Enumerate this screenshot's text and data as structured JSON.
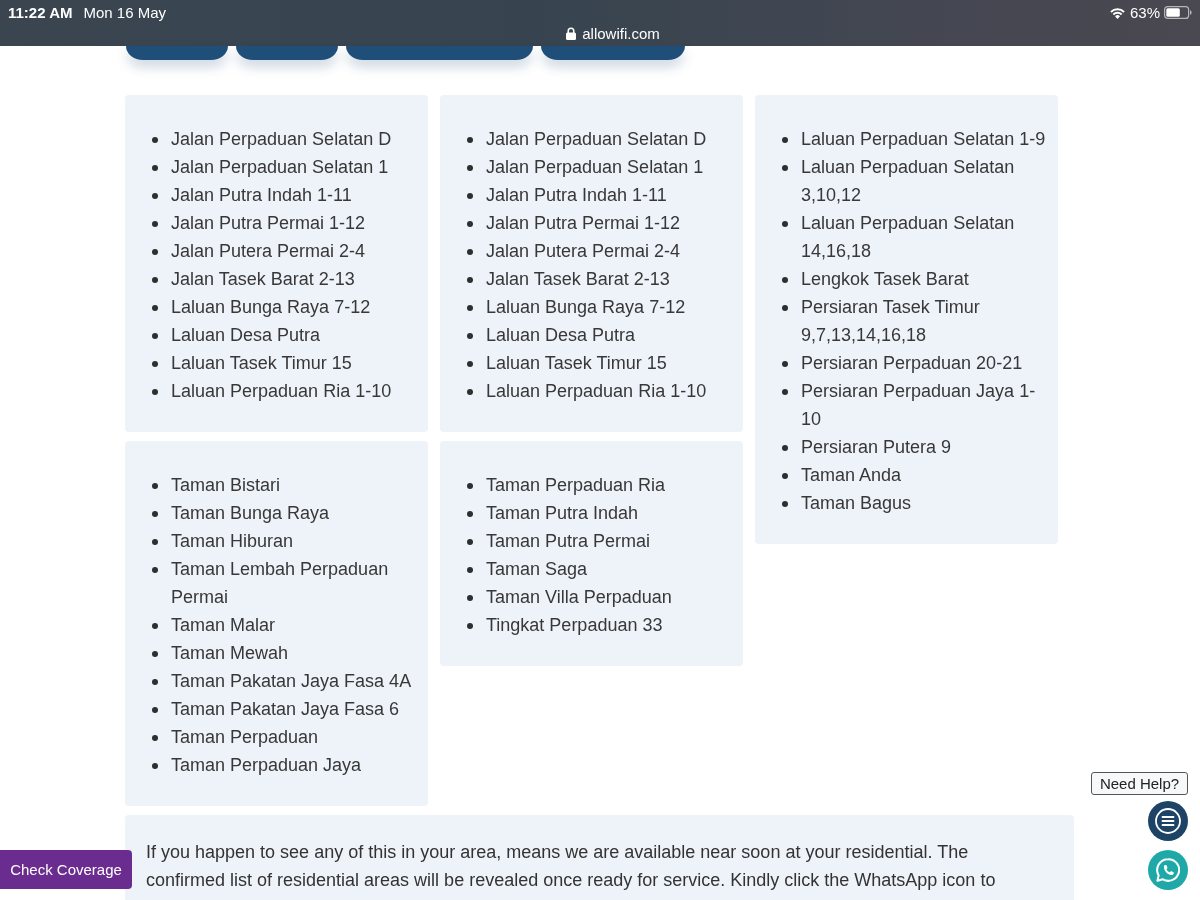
{
  "status_bar": {
    "time": "11:22 AM",
    "date": "Mon 16 May",
    "url": "allowifi.com",
    "battery": "63%"
  },
  "area_buttons": [
    {
      "kind": "short"
    },
    {
      "kind": "short"
    },
    {
      "kind": "long"
    },
    {
      "kind": "medium"
    }
  ],
  "columns": [
    {
      "cards": [
        {
          "items": [
            "Jalan Perpaduan Selatan D",
            "Jalan Perpaduan Selatan 1",
            "Jalan Putra Indah 1-11",
            "Jalan Putra Permai 1-12",
            "Jalan Putera Permai 2-4",
            "Jalan Tasek Barat 2-13",
            "Laluan Bunga Raya 7-12",
            "Laluan Desa Putra",
            "Laluan Tasek Timur 15",
            "Laluan Perpaduan Ria 1-10"
          ]
        },
        {
          "items": [
            "Taman Bistari",
            "Taman Bunga Raya",
            "Taman Hiburan",
            "Taman Lembah Perpaduan Permai",
            "Taman Malar",
            "Taman Mewah",
            "Taman Pakatan Jaya Fasa 4A",
            "Taman Pakatan Jaya Fasa 6",
            "Taman Perpaduan",
            "Taman Perpaduan Jaya"
          ]
        }
      ]
    },
    {
      "cards": [
        {
          "items": [
            "Jalan Perpaduan Selatan D",
            "Jalan Perpaduan Selatan 1",
            "Jalan Putra Indah 1-11",
            "Jalan Putra Permai 1-12",
            "Jalan Putera Permai 2-4",
            "Jalan Tasek Barat 2-13",
            "Laluan Bunga Raya 7-12",
            "Laluan Desa Putra",
            "Laluan Tasek Timur 15",
            "Laluan Perpaduan Ria 1-10"
          ]
        },
        {
          "items": [
            "Taman Perpaduan Ria",
            "Taman Putra Indah",
            "Taman Putra Permai",
            "Taman Saga",
            "Taman Villa Perpaduan",
            "Tingkat Perpaduan 33"
          ]
        }
      ]
    },
    {
      "cards": [
        {
          "items": [
            "Laluan Perpaduan Selatan 1-9",
            "Laluan Perpaduan Selatan 3,10,12",
            "Laluan Perpaduan Selatan 14,16,18",
            "Lengkok Tasek Barat",
            "Persiaran Tasek Timur 9,7,13,14,16,18",
            "Persiaran Perpaduan 20-21",
            "Persiaran Perpaduan Jaya 1-10",
            "Persiaran Putera 9",
            "Taman Anda",
            "Taman Bagus"
          ]
        }
      ]
    }
  ],
  "notice": {
    "text": "If you happen to see any of this in your area, means we are available near soon at your residential. The confirmed list of residential areas will be revealed once ready for service. Kindly click the WhatsApp icon to"
  },
  "check_coverage_button": {
    "label": "Check Coverage"
  },
  "help": {
    "label": "Need Help?"
  }
}
